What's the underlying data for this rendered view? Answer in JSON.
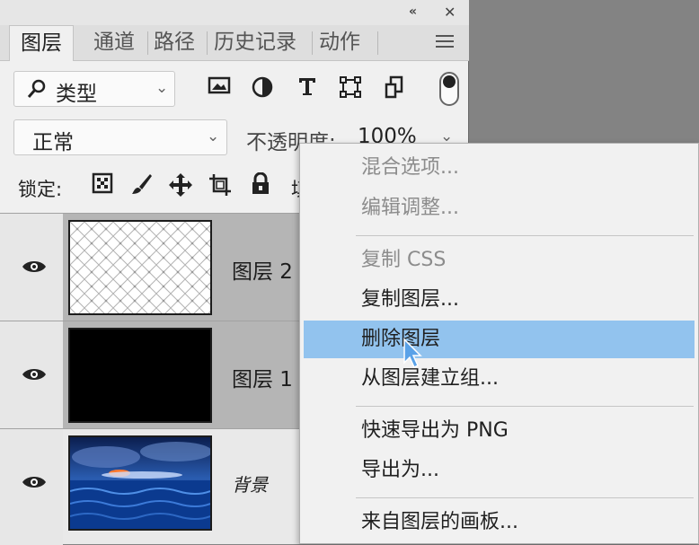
{
  "panel": {
    "tabs": [
      "图层",
      "通道",
      "路径",
      "历史记录",
      "动作"
    ],
    "kind_filter": {
      "label": "类型"
    },
    "blend_mode": "正常",
    "opacity": {
      "label": "不透明度:",
      "value": "100%"
    },
    "lock": {
      "label": "锁定:",
      "fill_partial": "填"
    },
    "layers": [
      {
        "name": "图层 2",
        "visible": true,
        "thumbnail": "pattern"
      },
      {
        "name": "图层 1",
        "visible": true,
        "thumbnail": "black"
      },
      {
        "name": "背景",
        "visible": true,
        "thumbnail": "ocean-photo"
      }
    ]
  },
  "context_menu": {
    "items": [
      {
        "label": "混合选项...",
        "enabled": false
      },
      {
        "label": "编辑调整...",
        "enabled": false
      },
      {
        "label": "复制 CSS",
        "enabled": false
      },
      {
        "label": "复制图层...",
        "enabled": true
      },
      {
        "label": "删除图层",
        "enabled": true,
        "highlighted": true
      },
      {
        "label": "从图层建立组...",
        "enabled": true
      },
      {
        "label": "快速导出为 PNG",
        "enabled": true
      },
      {
        "label": "导出为...",
        "enabled": true
      },
      {
        "label": "来自图层的画板...",
        "enabled": true
      }
    ]
  },
  "colors": {
    "menu_highlight": "#92c3ee",
    "selected_row": "#b5b5b5"
  }
}
